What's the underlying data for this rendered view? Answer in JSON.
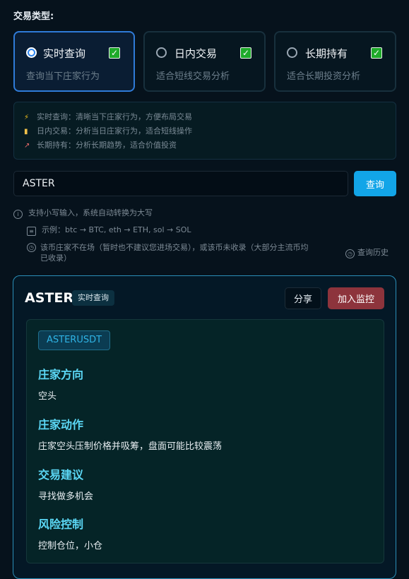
{
  "trade_type_label": "交易类型:",
  "trade_types": [
    {
      "title": "实时查询",
      "desc": "查询当下庄家行为",
      "selected": true
    },
    {
      "title": "日内交易",
      "desc": "适合短线交易分析",
      "selected": false
    },
    {
      "title": "长期持有",
      "desc": "适合长期投资分析",
      "selected": false
    }
  ],
  "tips": [
    {
      "icon": "lightning-icon",
      "text": "实时查询：清晰当下庄家行为，方便布局交易"
    },
    {
      "icon": "bar-chart-icon",
      "text": "日内交易：分析当日庄家行为，适合短线操作"
    },
    {
      "icon": "trend-chart-icon",
      "text": "长期持有：分析长期趋势，适合价值投资"
    }
  ],
  "search": {
    "value": "ASTER",
    "button": "查询"
  },
  "hints": {
    "lowercase": "支持小写输入，系统自动转换为大写",
    "example": "示例：btc → BTC, eth → ETH, sol → SOL",
    "warning_line1": "该币庄家不在场（暂时也不建议您进场交易），或该币未收录（大部分主流币均",
    "warning_line2": "已收录）",
    "history": "查询历史"
  },
  "result": {
    "coin": "ASTER",
    "mode": "实时查询",
    "share": "分享",
    "monitor": "加入监控",
    "symbol": "ASTERUSDT",
    "sections": [
      {
        "title": "庄家方向",
        "text": "空头"
      },
      {
        "title": "庄家动作",
        "text": "庄家空头压制价格并吸筹，盘面可能比较震荡"
      },
      {
        "title": "交易建议",
        "text": "寻找做多机会"
      },
      {
        "title": "风险控制",
        "text": "控制仓位，小仓"
      }
    ]
  },
  "colors": {
    "accent": "#12a5e8",
    "section_title": "#5bd7f5",
    "monitor_button": "#8d343c",
    "check": "#1faa2a"
  }
}
